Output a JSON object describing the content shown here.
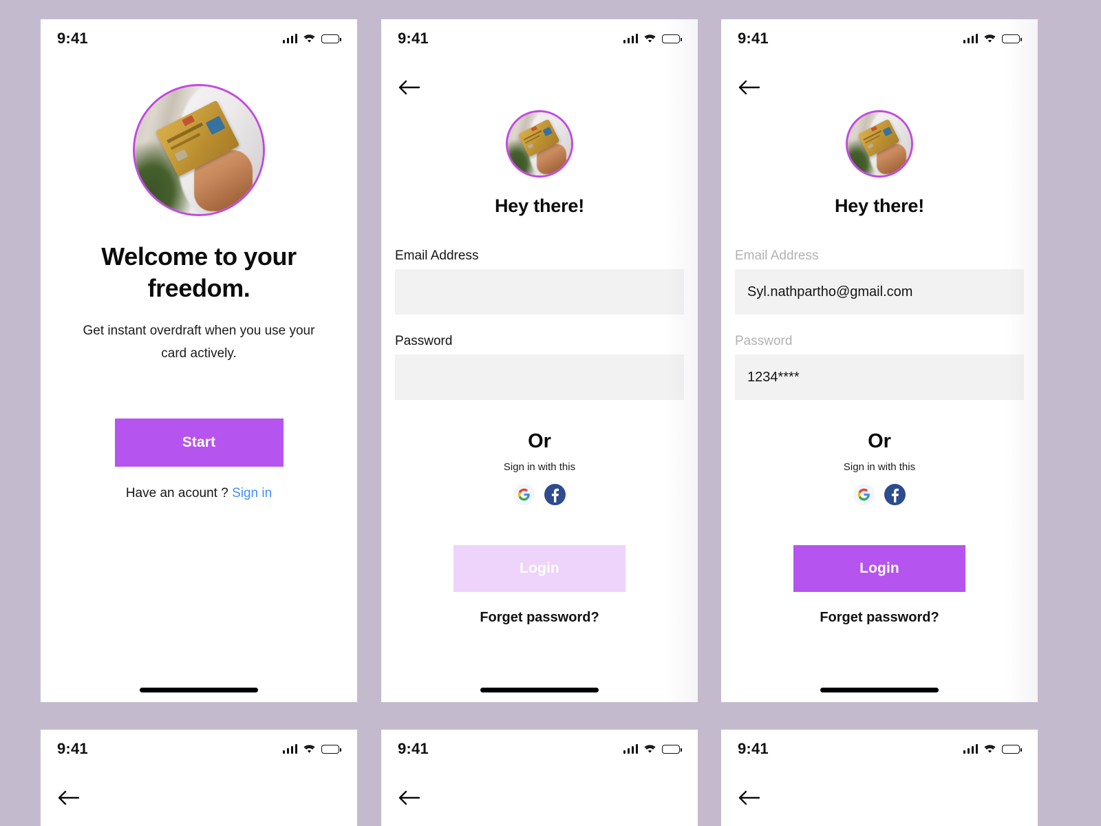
{
  "theme": {
    "canvas_background": "#c3bbcd",
    "accent_purple": "#b554ee",
    "accent_purple_disabled": "#eed3fa",
    "avatar_ring": "#c24ae0",
    "link_blue": "#3f8ff5",
    "input_background": "#f2f2f2",
    "label_inactive": "#b2b2b2",
    "google_badge": "#f1f6fe",
    "facebook_badge": "#2d4b8e"
  },
  "status_bar": {
    "time": "9:41",
    "cellular_icon": "cellular-signal-icon",
    "wifi_icon": "wifi-icon",
    "battery_icon": "battery-full-icon"
  },
  "icons": {
    "back": "back-arrow-icon",
    "google": "google-logo-icon",
    "facebook": "facebook-logo-icon",
    "avatar": "credit-card-photo-avatar",
    "home_indicator": "home-indicator"
  },
  "screen_welcome": {
    "name": "Welcome / Onboarding",
    "title": "Welcome to your freedom.",
    "subtitle": "Get instant overdraft when you use your card actively.",
    "primary_button": "Start",
    "footer_prompt": "Have an acount ?",
    "footer_link": "Sign in"
  },
  "screen_login_empty": {
    "name": "Login — empty state",
    "heading": "Hey there!",
    "fields": [
      {
        "label": "Email Address",
        "value": "",
        "placeholder": "",
        "state": "active"
      },
      {
        "label": "Password",
        "value": "",
        "placeholder": "",
        "state": "active"
      }
    ],
    "divider": "Or",
    "social_caption": "Sign in with this",
    "social_buttons": [
      "Google",
      "Facebook"
    ],
    "primary_button": "Login",
    "primary_button_state": "disabled",
    "forget_link": "Forget password?"
  },
  "screen_login_filled": {
    "name": "Login — filled state",
    "heading": "Hey there!",
    "fields": [
      {
        "label": "Email Address",
        "value": "Syl.nathpartho@gmail.com",
        "placeholder": "",
        "state": "filled"
      },
      {
        "label": "Password",
        "value": "1234****",
        "placeholder": "",
        "state": "filled"
      }
    ],
    "divider": "Or",
    "social_caption": "Sign in with this",
    "social_buttons": [
      "Google",
      "Facebook"
    ],
    "primary_button": "Login",
    "primary_button_state": "enabled",
    "forget_link": "Forget password?"
  },
  "bottom_row": [
    {
      "name": "Partial screen 4",
      "time": "9:41"
    },
    {
      "name": "Partial screen 5",
      "time": "9:41"
    },
    {
      "name": "Partial screen 6",
      "time": "9:41"
    }
  ]
}
